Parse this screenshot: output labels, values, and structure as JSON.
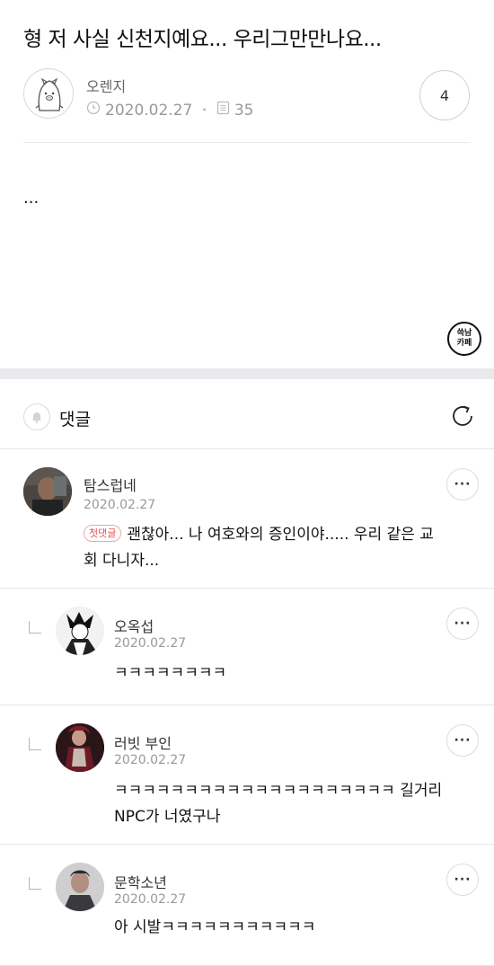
{
  "post": {
    "title": "형 저 사실 신천지예요... 우리그만만나요...",
    "author": "오렌지",
    "date": "2020.02.27",
    "views": "35",
    "comment_count": "4",
    "body": "..."
  },
  "cafe_logo": {
    "line1": "쓱남",
    "line2": "카페"
  },
  "comments_section": {
    "label": "댓글"
  },
  "comments": [
    {
      "name": "탐스럽네",
      "date": "2020.02.27",
      "badge": "첫댓글",
      "text_line1": "괜찮아... 나 여호와의 증인이야..... 우리 같은 교",
      "text_line2": "회 다니자..."
    },
    {
      "name": "오옥섭",
      "date": "2020.02.27",
      "text_line1": "ㅋㅋㅋㅋㅋㅋㅋㅋ"
    },
    {
      "name": "러빗 부인",
      "date": "2020.02.27",
      "text_line1": "ㅋㅋㅋㅋㅋㅋㅋㅋㅋㅋㅋㅋㅋㅋㅋㅋㅋㅋㅋㅋ 길거리",
      "text_line2": "NPC가 너였구나"
    },
    {
      "name": "문학소년",
      "date": "2020.02.27",
      "text_line1": "아 시발ㅋㅋㅋㅋㅋㅋㅋㅋㅋㅋㅋ"
    }
  ],
  "more_label": "···"
}
